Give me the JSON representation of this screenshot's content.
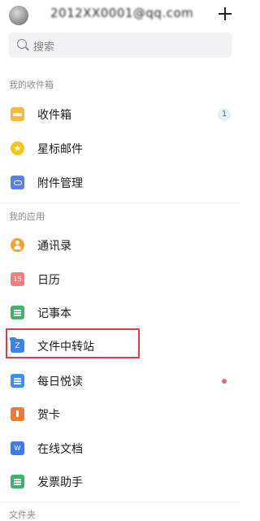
{
  "header": {
    "account": "2012XX0001@qq.com",
    "add_icon": "plus-icon"
  },
  "search": {
    "placeholder": "搜索",
    "icon": "search-icon"
  },
  "sections": {
    "inbox": "我的收件箱",
    "apps": "我的应用",
    "folders": "文件夹"
  },
  "inbox_items": [
    {
      "label": "收件箱",
      "icon": "inbox-icon",
      "badge": "1"
    },
    {
      "label": "星标邮件",
      "icon": "star-icon"
    },
    {
      "label": "附件管理",
      "icon": "attachment-icon"
    }
  ],
  "app_items": [
    {
      "label": "通讯录",
      "icon": "contacts-icon"
    },
    {
      "label": "日历",
      "icon": "calendar-icon"
    },
    {
      "label": "记事本",
      "icon": "notes-icon"
    },
    {
      "label": "文件中转站",
      "icon": "file-transfer-icon",
      "highlighted": true
    },
    {
      "label": "每日悦读",
      "icon": "daily-reading-icon",
      "unread_dot": true
    },
    {
      "label": "贺卡",
      "icon": "greeting-card-icon"
    },
    {
      "label": "在线文档",
      "icon": "online-docs-icon"
    },
    {
      "label": "发票助手",
      "icon": "invoice-icon"
    }
  ],
  "colors": {
    "highlight_border": "#d6404a",
    "unread_dot": "#e86a6a",
    "badge_bg": "#e6eef9",
    "badge_text": "#3c6fb0"
  }
}
